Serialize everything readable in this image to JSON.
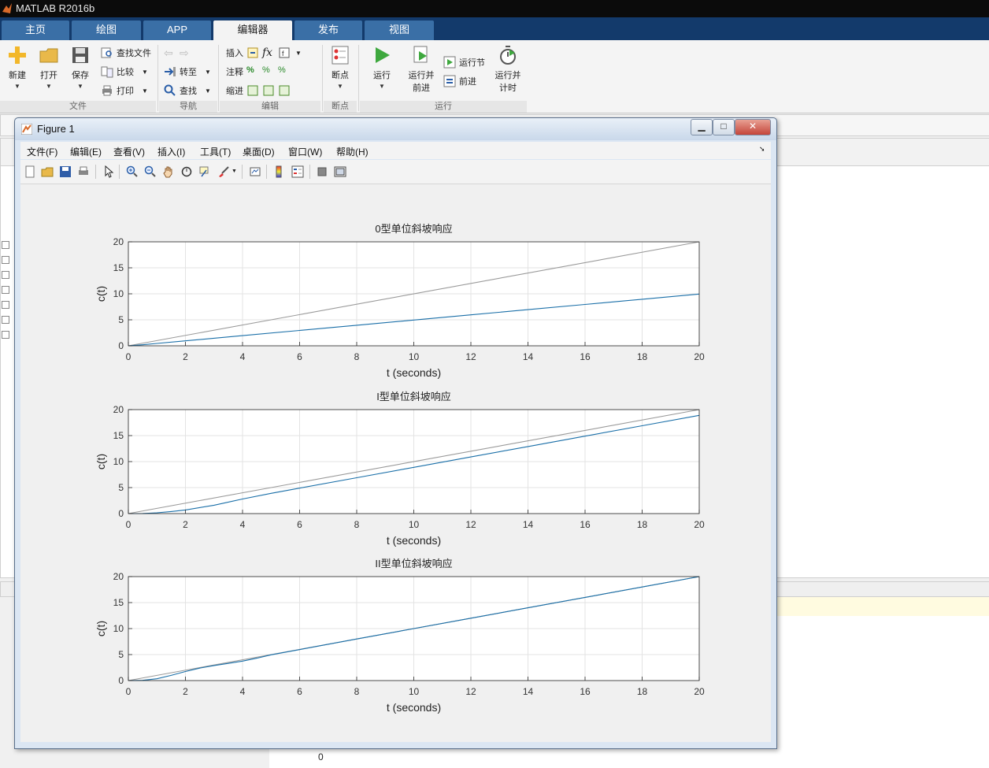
{
  "app": {
    "title": "MATLAB R2016b"
  },
  "tabs": [
    {
      "label": "主页"
    },
    {
      "label": "绘图"
    },
    {
      "label": "APP"
    },
    {
      "label": "编辑器",
      "active": true
    },
    {
      "label": "发布"
    },
    {
      "label": "视图"
    }
  ],
  "ribbon": {
    "file": {
      "group": "文件",
      "new": "新建",
      "open": "打开",
      "save": "保存",
      "find_files": "查找文件",
      "compare": "比较",
      "print": "打印"
    },
    "nav": {
      "group": "导航",
      "goto": "转至",
      "find": "查找"
    },
    "edit": {
      "group": "编辑",
      "insert": "插入",
      "comment": "注释",
      "indent": "缩进",
      "fx": "fx"
    },
    "breakpoints": {
      "group": "断点",
      "label": "断点"
    },
    "run": {
      "group": "运行",
      "run": "运行",
      "run_advance_1": "运行并",
      "run_advance_2": "前进",
      "run_section": "运行节",
      "advance": "前进",
      "run_time_1": "运行并",
      "run_time_2": "计时"
    }
  },
  "background": {
    "number": "0"
  },
  "figure": {
    "title": "Figure 1",
    "menu": [
      "文件(F)",
      "编辑(E)",
      "查看(V)",
      "插入(I)",
      "工具(T)",
      "桌面(D)",
      "窗口(W)",
      "帮助(H)"
    ],
    "toolbar_icons": [
      "new-figure-icon",
      "open-file-icon",
      "save-icon",
      "print-icon",
      "pointer-icon",
      "zoom-in-icon",
      "zoom-out-icon",
      "pan-icon",
      "rotate-icon",
      "data-cursor-icon",
      "brush-icon",
      "link-icon",
      "colorbar-icon",
      "legend-icon",
      "hide-plot-tools-icon",
      "show-plot-tools-icon"
    ]
  },
  "chart_data": [
    {
      "type": "line",
      "title": "0型单位斜坡响应",
      "xlabel": "t (seconds)",
      "ylabel": "c(t)",
      "xlim": [
        0,
        20
      ],
      "ylim": [
        0,
        20
      ],
      "xticks": [
        0,
        2,
        4,
        6,
        8,
        10,
        12,
        14,
        16,
        18,
        20
      ],
      "yticks": [
        0,
        5,
        10,
        15,
        20
      ],
      "grid": true,
      "series": [
        {
          "color": "#9a9a9a",
          "x": [
            0,
            20
          ],
          "y": [
            0,
            20
          ]
        },
        {
          "color": "#1a6fa8",
          "x": [
            0,
            0.5,
            1,
            2,
            4,
            6,
            8,
            10,
            12,
            14,
            16,
            18,
            20
          ],
          "y": [
            0,
            0.2,
            0.45,
            0.95,
            1.95,
            2.95,
            3.95,
            4.95,
            5.95,
            6.95,
            7.95,
            8.95,
            9.95
          ]
        }
      ]
    },
    {
      "type": "line",
      "title": "I型单位斜坡响应",
      "xlabel": "t (seconds)",
      "ylabel": "c(t)",
      "xlim": [
        0,
        20
      ],
      "ylim": [
        0,
        20
      ],
      "xticks": [
        0,
        2,
        4,
        6,
        8,
        10,
        12,
        14,
        16,
        18,
        20
      ],
      "yticks": [
        0,
        5,
        10,
        15,
        20
      ],
      "grid": true,
      "series": [
        {
          "color": "#9a9a9a",
          "x": [
            0,
            20
          ],
          "y": [
            0,
            20
          ]
        },
        {
          "color": "#1a6fa8",
          "x": [
            0,
            0.5,
            1,
            1.5,
            2,
            3,
            4,
            5,
            6,
            8,
            10,
            12,
            14,
            16,
            18,
            20
          ],
          "y": [
            0,
            0.02,
            0.15,
            0.4,
            0.7,
            1.6,
            2.8,
            3.9,
            4.9,
            6.9,
            8.9,
            10.9,
            12.9,
            14.9,
            16.9,
            18.9
          ]
        }
      ]
    },
    {
      "type": "line",
      "title": "II型单位斜坡响应",
      "xlabel": "t (seconds)",
      "ylabel": "c(t)",
      "xlim": [
        0,
        20
      ],
      "ylim": [
        0,
        20
      ],
      "xticks": [
        0,
        2,
        4,
        6,
        8,
        10,
        12,
        14,
        16,
        18,
        20
      ],
      "yticks": [
        0,
        5,
        10,
        15,
        20
      ],
      "grid": true,
      "series": [
        {
          "color": "#9a9a9a",
          "x": [
            0,
            20
          ],
          "y": [
            0,
            20
          ]
        },
        {
          "color": "#1a6fa8",
          "x": [
            0,
            0.5,
            1,
            1.5,
            2,
            2.5,
            3,
            3.5,
            4,
            4.5,
            5,
            6,
            8,
            10,
            12,
            14,
            16,
            18,
            20
          ],
          "y": [
            0,
            0.05,
            0.35,
            1.0,
            1.75,
            2.4,
            2.9,
            3.3,
            3.75,
            4.3,
            4.95,
            5.95,
            8.0,
            10.0,
            12.0,
            14.0,
            16.0,
            18.0,
            20.0
          ]
        }
      ]
    }
  ]
}
